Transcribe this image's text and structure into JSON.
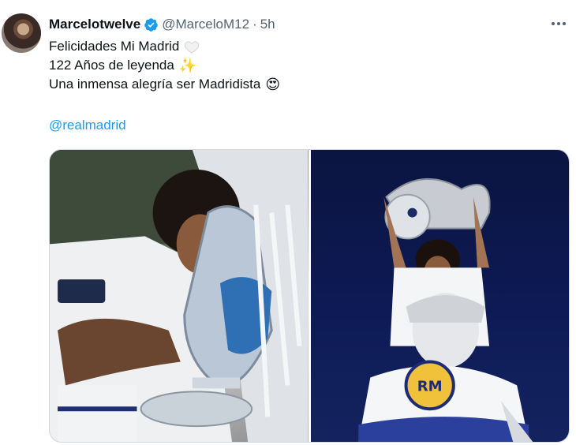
{
  "tweet": {
    "display_name": "Marcelotwelve",
    "handle": "@MarceloM12",
    "separator": "·",
    "time": "5h",
    "lines": [
      {
        "text": "Felicidades Mi Madrid",
        "emoji": "white-heart-icon"
      },
      {
        "text": "122 Años de leyenda",
        "emoji": "sparkles-icon",
        "glyph": "✨"
      },
      {
        "text": "Una inmensa alegría ser Madridista",
        "emoji": "heart-eyes-icon",
        "glyph": "😍"
      }
    ],
    "mention": "@realmadrid",
    "media": [
      {
        "name": "photo-marcelo-kissing-trophy"
      },
      {
        "name": "photo-marcelo-holding-trophy-cibeles"
      }
    ]
  },
  "colors": {
    "text": "#0f1419",
    "secondary": "#536471",
    "link": "#1d9bf0",
    "verified": "#1d9bf0"
  }
}
